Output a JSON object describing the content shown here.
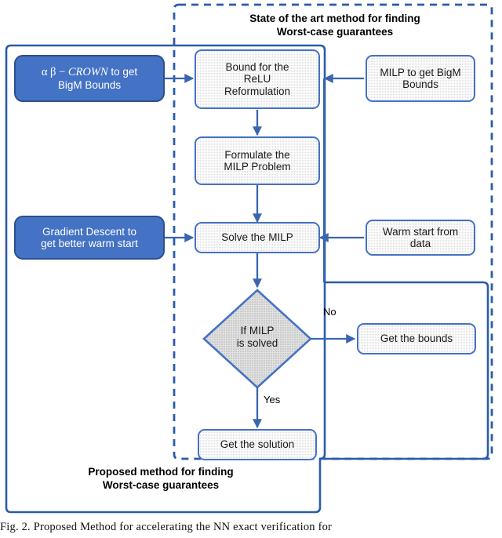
{
  "figure": {
    "caption": "Fig. 2.     Proposed Method for accelerating the NN exact verification for"
  },
  "regions": {
    "state_of_art": {
      "title_line1": "State of the art method for finding",
      "title_line2": "Worst-case guarantees",
      "border_style": "dashed",
      "color": "#2B5BA8"
    },
    "proposed": {
      "title_line1": "Proposed method for finding",
      "title_line2": "Worst-case guarantees",
      "border_style": "solid",
      "color": "#2B5BA8"
    }
  },
  "nodes": {
    "crown": {
      "label": "α β − CROWN to get BigM Bounds",
      "line1_greek": "α β",
      "line1_dash": " − ",
      "line1_italic": "CROWN",
      "line1_tail": " to get",
      "line2": "BigM Bounds",
      "style": "blue"
    },
    "bound_relu": {
      "line1": "Bound for the",
      "line2": "ReLU",
      "line3": "Reformulation",
      "style": "grey"
    },
    "milp_bigm": {
      "line1": "MILP to get BigM",
      "line2": "Bounds",
      "style": "grey"
    },
    "formulate": {
      "line1": "Formulate the",
      "line2": "MILP Problem",
      "style": "grey"
    },
    "gradient": {
      "line1": "Gradient Descent to",
      "line2": "get better warm start",
      "style": "blue"
    },
    "solve_milp": {
      "line1": "Solve the MILP",
      "style": "grey"
    },
    "warm_start": {
      "line1": "Warm start from",
      "line2": "data",
      "style": "grey"
    },
    "decision": {
      "line1": "If MILP",
      "line2": "is solved",
      "style": "diamond-grey"
    },
    "get_bounds": {
      "line1": "Get the bounds",
      "style": "grey"
    },
    "get_solution": {
      "line1": "Get the solution",
      "style": "grey"
    }
  },
  "edge_labels": {
    "no": "No",
    "yes": "Yes"
  },
  "colors": {
    "accent_blue": "#4472C4",
    "line_blue": "#2B5BA8",
    "box_grey": "#dedede",
    "blue_border": "#2c4f8f",
    "text_dark": "#1a1a1a",
    "text_light": "#ffffff"
  }
}
